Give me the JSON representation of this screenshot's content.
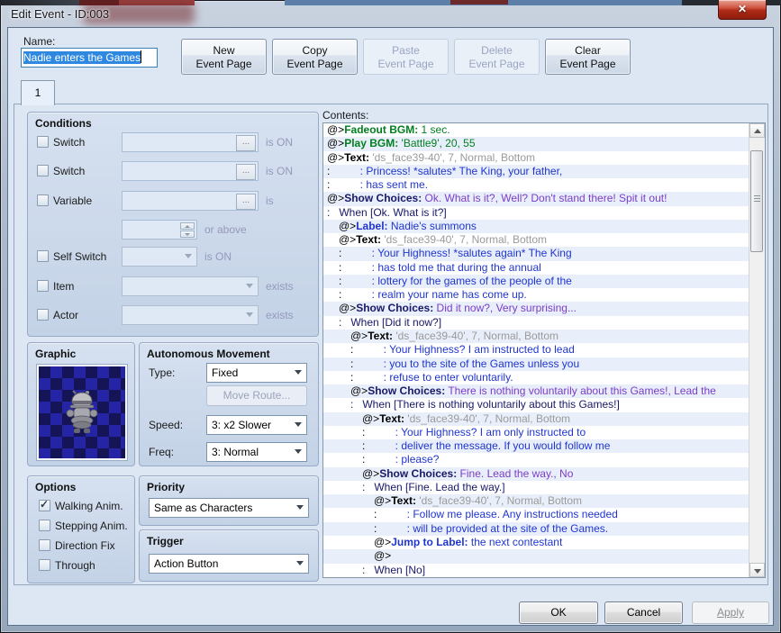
{
  "window": {
    "title": "Edit Event - ID:003",
    "close_glyph": "✕"
  },
  "header": {
    "name_label": "Name:",
    "name_value": "Nadie enters the Games",
    "buttons": [
      {
        "line1": "New",
        "line2": "Event Page",
        "enabled": true
      },
      {
        "line1": "Copy",
        "line2": "Event Page",
        "enabled": true
      },
      {
        "line1": "Paste",
        "line2": "Event Page",
        "enabled": false
      },
      {
        "line1": "Delete",
        "line2": "Event Page",
        "enabled": false
      },
      {
        "line1": "Clear",
        "line2": "Event Page",
        "enabled": true
      }
    ]
  },
  "tab": {
    "label": "1"
  },
  "conditions": {
    "title": "Conditions",
    "ellipsis": "...",
    "row1": {
      "label": "Switch",
      "suffix": "is ON"
    },
    "row2": {
      "label": "Switch",
      "suffix": "is ON"
    },
    "row3": {
      "label": "Variable",
      "suffix": "is"
    },
    "row4": {
      "suffix": "or above"
    },
    "row5": {
      "label": "Self Switch",
      "suffix": "is ON"
    },
    "row6": {
      "label": "Item",
      "suffix": "exists"
    },
    "row7": {
      "label": "Actor",
      "suffix": "exists"
    }
  },
  "graphic": {
    "title": "Graphic",
    "sprite": "armored-knight-character"
  },
  "movement": {
    "title": "Autonomous Movement",
    "type_label": "Type:",
    "type_value": "Fixed",
    "move_route_label": "Move Route...",
    "speed_label": "Speed:",
    "speed_value": "3: x2 Slower",
    "freq_label": "Freq:",
    "freq_value": "3: Normal"
  },
  "options": {
    "title": "Options",
    "items": [
      {
        "label": "Walking Anim.",
        "checked": true
      },
      {
        "label": "Stepping Anim.",
        "checked": false
      },
      {
        "label": "Direction Fix",
        "checked": false
      },
      {
        "label": "Through",
        "checked": false
      }
    ]
  },
  "priority": {
    "title": "Priority",
    "value": "Same as Characters"
  },
  "trigger": {
    "title": "Trigger",
    "value": "Action Button"
  },
  "contents": {
    "label": "Contents:",
    "rows": [
      {
        "ind": 0,
        "alt": false,
        "segs": [
          [
            "p",
            "@>"
          ],
          [
            "gb",
            "Fadeout BGM:"
          ],
          [
            "g",
            " 1 sec."
          ]
        ]
      },
      {
        "ind": 0,
        "alt": true,
        "segs": [
          [
            "p",
            "@>"
          ],
          [
            "gb",
            "Play BGM:"
          ],
          [
            "g",
            " 'Battle9', 20, 55"
          ]
        ]
      },
      {
        "ind": 0,
        "alt": false,
        "segs": [
          [
            "p",
            "@>"
          ],
          [
            "b",
            "Text:"
          ],
          [
            "gy",
            " 'ds_face39-40', 7, Normal, Bottom"
          ]
        ]
      },
      {
        "ind": 0,
        "alt": true,
        "segs": [
          [
            "p",
            ":"
          ],
          [
            "bl",
            "          : Princess! *salutes* The King, your father,"
          ]
        ]
      },
      {
        "ind": 0,
        "alt": false,
        "segs": [
          [
            "p",
            ":"
          ],
          [
            "bl",
            "          : has sent me."
          ]
        ]
      },
      {
        "ind": 0,
        "alt": true,
        "segs": [
          [
            "p",
            "@>"
          ],
          [
            "nb",
            "Show Choices:"
          ],
          [
            "pu",
            " Ok. What is it?, Well? Don't stand there! Spit it out!"
          ]
        ]
      },
      {
        "ind": 0,
        "alt": false,
        "segs": [
          [
            "nv",
            ":   When [Ok. What is it?]"
          ]
        ]
      },
      {
        "ind": 1,
        "alt": true,
        "segs": [
          [
            "p",
            "@>"
          ],
          [
            "blb",
            "Label:"
          ],
          [
            "bl",
            " Nadie's summons"
          ]
        ]
      },
      {
        "ind": 1,
        "alt": false,
        "segs": [
          [
            "p",
            "@>"
          ],
          [
            "b",
            "Text:"
          ],
          [
            "gy",
            " 'ds_face39-40', 7, Normal, Bottom"
          ]
        ]
      },
      {
        "ind": 1,
        "alt": true,
        "segs": [
          [
            "p",
            ":"
          ],
          [
            "bl",
            "          : Your Highness! *salutes again* The King"
          ]
        ]
      },
      {
        "ind": 1,
        "alt": false,
        "segs": [
          [
            "p",
            ":"
          ],
          [
            "bl",
            "          : has told me that during the annual"
          ]
        ]
      },
      {
        "ind": 1,
        "alt": true,
        "segs": [
          [
            "p",
            ":"
          ],
          [
            "bl",
            "          : lottery for the games of the people of the"
          ]
        ]
      },
      {
        "ind": 1,
        "alt": false,
        "segs": [
          [
            "p",
            ":"
          ],
          [
            "bl",
            "          : realm your name has come up."
          ]
        ]
      },
      {
        "ind": 1,
        "alt": true,
        "segs": [
          [
            "p",
            "@>"
          ],
          [
            "nb",
            "Show Choices:"
          ],
          [
            "pu",
            " Did it now?, Very surprising..."
          ]
        ]
      },
      {
        "ind": 1,
        "alt": false,
        "segs": [
          [
            "nv",
            ":   When [Did it now?]"
          ]
        ]
      },
      {
        "ind": 2,
        "alt": true,
        "segs": [
          [
            "p",
            "@>"
          ],
          [
            "b",
            "Text:"
          ],
          [
            "gy",
            " 'ds_face39-40', 7, Normal, Bottom"
          ]
        ]
      },
      {
        "ind": 2,
        "alt": false,
        "segs": [
          [
            "p",
            ":"
          ],
          [
            "bl",
            "          : Your Highness? I am instructed to lead"
          ]
        ]
      },
      {
        "ind": 2,
        "alt": true,
        "segs": [
          [
            "p",
            ":"
          ],
          [
            "bl",
            "          : you to the site of the Games unless you"
          ]
        ]
      },
      {
        "ind": 2,
        "alt": false,
        "segs": [
          [
            "p",
            ":"
          ],
          [
            "bl",
            "          : refuse to enter voluntarily."
          ]
        ]
      },
      {
        "ind": 2,
        "alt": true,
        "segs": [
          [
            "p",
            "@>"
          ],
          [
            "nb",
            "Show Choices:"
          ],
          [
            "pu",
            " There is nothing voluntarily about this Games!, Lead the"
          ]
        ]
      },
      {
        "ind": 2,
        "alt": false,
        "segs": [
          [
            "nv",
            ":   When [There is nothing voluntarily about this Games!]"
          ]
        ]
      },
      {
        "ind": 3,
        "alt": true,
        "segs": [
          [
            "p",
            "@>"
          ],
          [
            "b",
            "Text:"
          ],
          [
            "gy",
            " 'ds_face39-40', 7, Normal, Bottom"
          ]
        ]
      },
      {
        "ind": 3,
        "alt": false,
        "segs": [
          [
            "p",
            ":"
          ],
          [
            "bl",
            "          : Your Highness? I am only instructed to"
          ]
        ]
      },
      {
        "ind": 3,
        "alt": true,
        "segs": [
          [
            "p",
            ":"
          ],
          [
            "bl",
            "          : deliver the message. If you would follow me"
          ]
        ]
      },
      {
        "ind": 3,
        "alt": false,
        "segs": [
          [
            "p",
            ":"
          ],
          [
            "bl",
            "          : please?"
          ]
        ]
      },
      {
        "ind": 3,
        "alt": true,
        "segs": [
          [
            "p",
            "@>"
          ],
          [
            "nb",
            "Show Choices:"
          ],
          [
            "pu",
            " Fine. Lead the way., No"
          ]
        ]
      },
      {
        "ind": 3,
        "alt": false,
        "segs": [
          [
            "nv",
            ":   When [Fine. Lead the way.]"
          ]
        ]
      },
      {
        "ind": 4,
        "alt": true,
        "segs": [
          [
            "p",
            "@>"
          ],
          [
            "b",
            "Text:"
          ],
          [
            "gy",
            " 'ds_face39-40', 7, Normal, Bottom"
          ]
        ]
      },
      {
        "ind": 4,
        "alt": false,
        "segs": [
          [
            "p",
            ":"
          ],
          [
            "bl",
            "          : Follow me please. Any instructions needed"
          ]
        ]
      },
      {
        "ind": 4,
        "alt": true,
        "segs": [
          [
            "p",
            ":"
          ],
          [
            "bl",
            "          : will be provided at the site of the Games."
          ]
        ]
      },
      {
        "ind": 4,
        "alt": false,
        "segs": [
          [
            "p",
            "@>"
          ],
          [
            "blb",
            "Jump to Label:"
          ],
          [
            "bl",
            " the next contestant"
          ]
        ]
      },
      {
        "ind": 4,
        "alt": true,
        "segs": [
          [
            "p",
            "@>"
          ]
        ]
      },
      {
        "ind": 3,
        "alt": false,
        "segs": [
          [
            "nv",
            ":   When [No]"
          ]
        ]
      }
    ]
  },
  "footer": {
    "ok": "OK",
    "cancel": "Cancel",
    "apply": "Apply"
  },
  "colors": {
    "dialog_bg": "#dde7f4",
    "alt_row_bg": "#e9effa",
    "selection_blue": "#2f88e0",
    "audio_green": "#007f1f",
    "message_blue": "#1f35cf",
    "choice_purple": "#7a3dc8",
    "branch_navy": "#181868",
    "param_gray": "#9a9a9a",
    "close_red": "#b02a18"
  }
}
